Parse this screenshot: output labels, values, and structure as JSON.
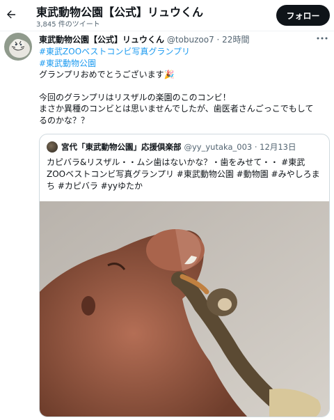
{
  "header": {
    "title": "東武動物公園【公式】リュウくん",
    "tweet_count": "3,845 件のツイート",
    "follow_label": "フォロー"
  },
  "tweet": {
    "display_name": "東武動物公園【公式】リュウくん",
    "handle_time": "@tobuzoo7 · 22時間",
    "hashtag_1": "#東武ZOOベストコンビ写真グランプリ",
    "hashtag_2": "#東武動物公園",
    "line_congrats": "グランプリおめでとうございます🎉",
    "line_1": "今回のグランプリはリスザルの楽園のこのコンビ！",
    "line_2": "まさか異種のコンビとは思いませんでしたが、歯医者さんごっこでもして",
    "line_3": "るのかな？？"
  },
  "quote": {
    "display_name": "宮代「東武動物公園」応援倶楽部",
    "handle_time": "@yy_yutaka_003 · 12月13日",
    "text_line_1": "カピバラ&リスザル・・ムシ歯はないかな？・歯をみせて・・ #東武",
    "text_line_2": "ZOOベストコンビ写真グランプリ #東武動物公園 #動物園 #みやしろま",
    "text_line_3": "ち #カピバラ #yyゆたか"
  },
  "icons": {
    "back": "back-arrow-icon",
    "more": "more-options-icon"
  },
  "colors": {
    "accent": "#1d9bf0",
    "follow_bg": "#0f1419",
    "secondary_text": "#536471"
  }
}
